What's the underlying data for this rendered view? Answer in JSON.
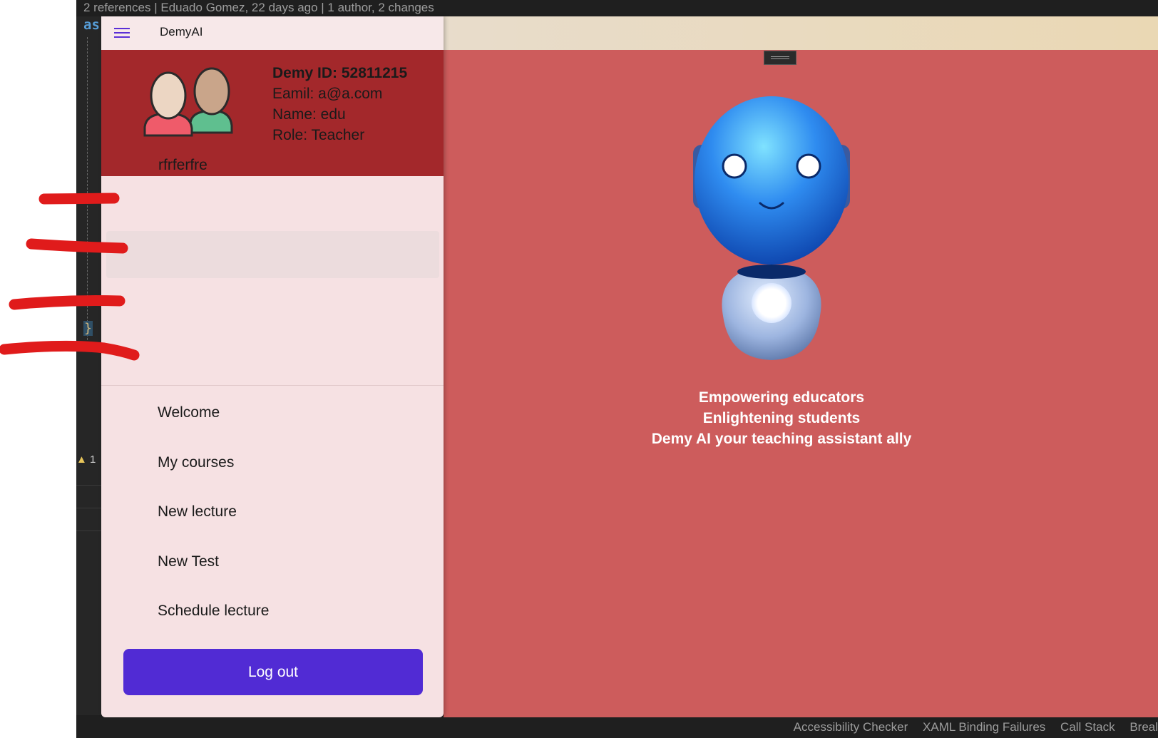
{
  "ide": {
    "codelens": "2 references | Eduado Gomez, 22 days ago | 1 author, 2 changes",
    "code_fragment": "as",
    "brace": "}",
    "warning_count": "1",
    "bottom_tabs": [
      "Accessibility Checker",
      "XAML Binding Failures",
      "Call Stack",
      "Breal"
    ]
  },
  "app": {
    "title": "DemyAI",
    "menu_icon": "hamburger-icon"
  },
  "profile": {
    "avatar_icon": "users-avatar-icon",
    "name": "rfrferfre",
    "demy_id": "Demy ID: 52811215",
    "email": "Eamil: a@a.com",
    "user_name": "Name: edu",
    "role": "Role: Teacher"
  },
  "nav": {
    "items": [
      {
        "label": "Welcome"
      },
      {
        "label": "My courses"
      },
      {
        "label": "New lecture"
      },
      {
        "label": "New Test"
      },
      {
        "label": "Schedule lecture"
      }
    ],
    "logout_label": "Log out"
  },
  "main": {
    "robot_icon": "robot-mascot-icon",
    "tagline": [
      "Empowering educators",
      "Enlightening students",
      "Demy AI your teaching assistant ally"
    ]
  },
  "colors": {
    "accent": "#512bd4",
    "profile_bg": "#a3282b",
    "main_bg": "#cd5c5c",
    "flyout_bg": "#f6e1e3",
    "annotation_red": "#e01b1b"
  }
}
